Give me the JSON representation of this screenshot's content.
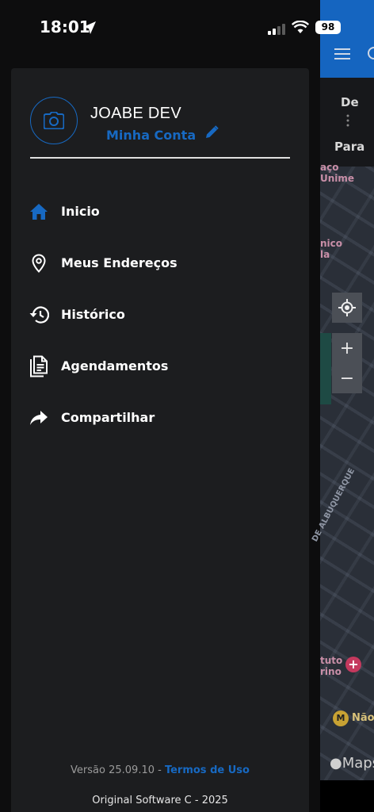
{
  "status_bar": {
    "time": "18:01",
    "battery": "98"
  },
  "drawer": {
    "user_name": "JOABE DEV",
    "account_link": "Minha Conta",
    "menu": [
      {
        "label": "Inicio",
        "icon": "home-icon"
      },
      {
        "label": "Meus Endereços",
        "icon": "location-pin-icon"
      },
      {
        "label": "Histórico",
        "icon": "history-icon"
      },
      {
        "label": "Agendamentos",
        "icon": "document-icon"
      },
      {
        "label": "Compartilhar",
        "icon": "share-icon"
      }
    ],
    "footer": {
      "version": "Versão 25.09.10 - ",
      "terms": "Termos de Uso",
      "copyright": "Original Software C - 2025"
    }
  },
  "background": {
    "from_label": "De",
    "to_label": "Para",
    "zoom_in": "+",
    "zoom_out": "−",
    "map_attribution": "Maps",
    "map_labels": [
      "aço Unime",
      "nico",
      "la",
      "DE ALBUQUERQUE",
      "tuto",
      "rino",
      "Não"
    ]
  },
  "colors": {
    "accent": "#1769c2",
    "drawer_bg": "#1c1d1f"
  }
}
